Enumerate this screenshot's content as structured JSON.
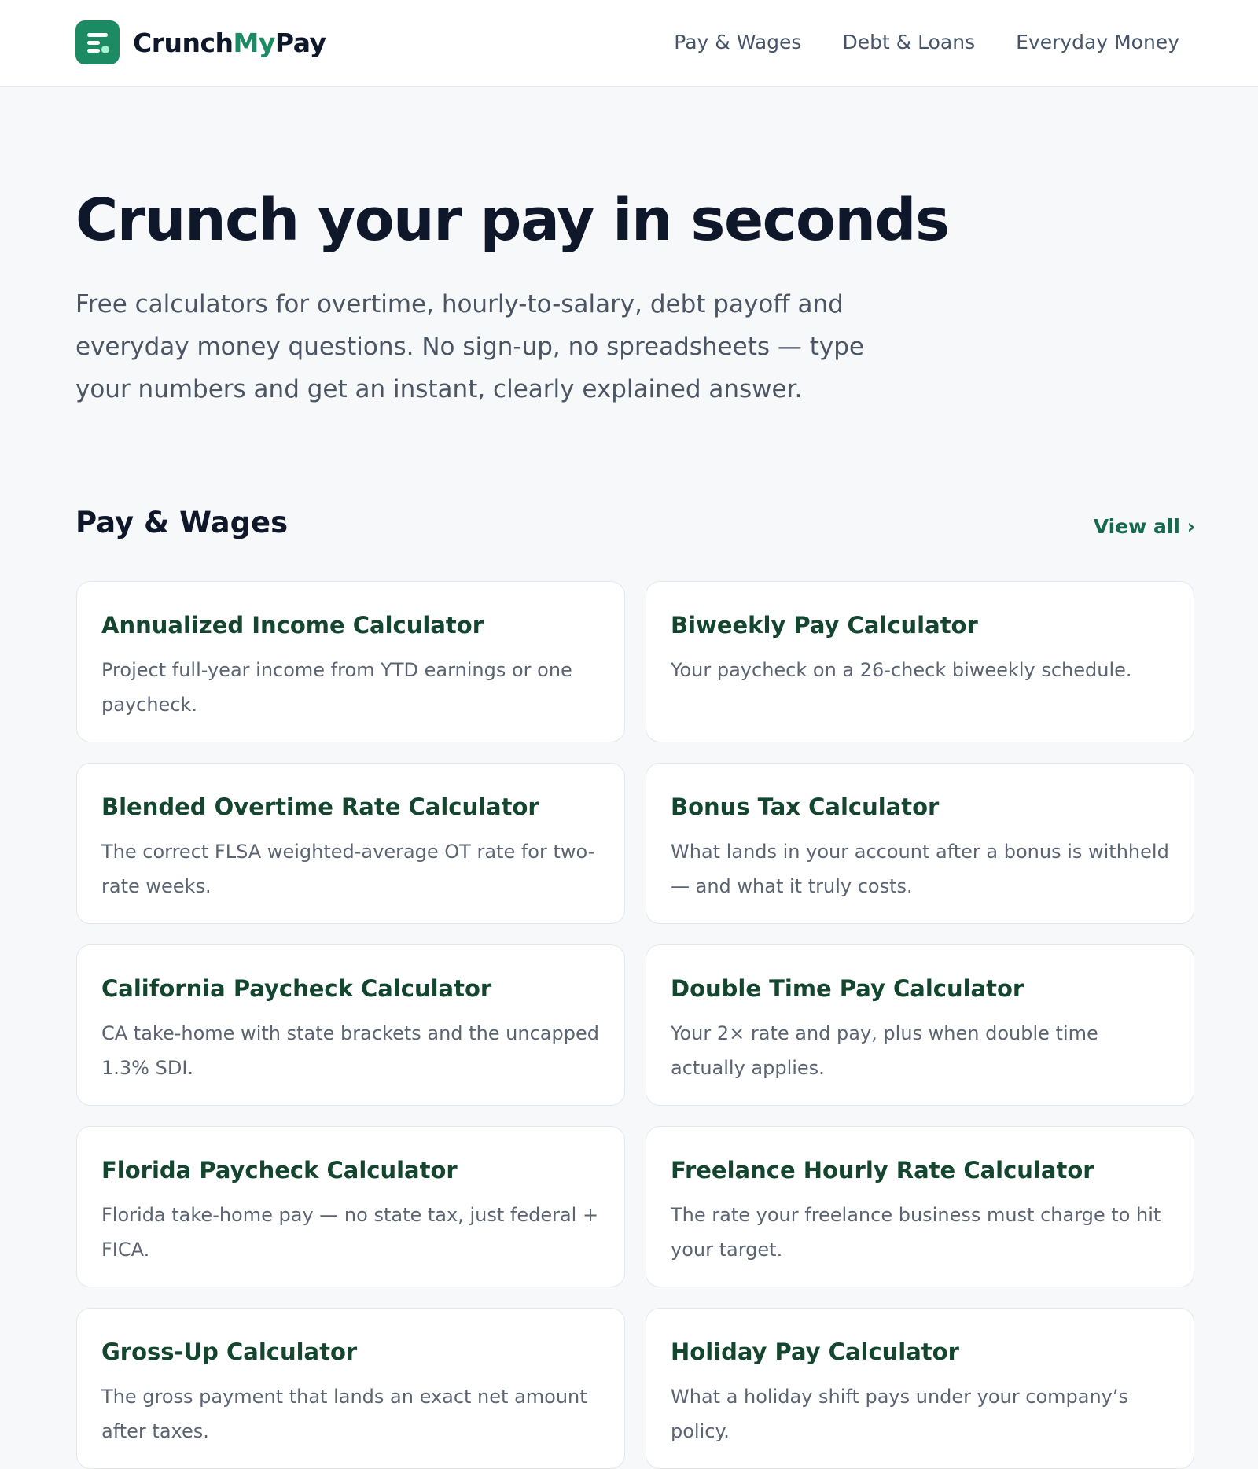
{
  "brand": {
    "name_part1": "Crunch",
    "name_part2": "My",
    "name_part3": "Pay",
    "accent_color": "#1c8a63",
    "logo_icon": "logo-bars-icon"
  },
  "nav": {
    "items": [
      {
        "label": "Pay & Wages"
      },
      {
        "label": "Debt & Loans"
      },
      {
        "label": "Everyday Money"
      }
    ]
  },
  "hero": {
    "title": "Crunch your pay in seconds",
    "subtitle": "Free calculators for overtime, hourly-to-salary, debt payoff and everyday money questions. No sign-up, no spreadsheets — type your numbers and get an instant, clearly explained answer."
  },
  "section": {
    "title": "Pay & Wages",
    "view_all_label": "View all ›",
    "cards": [
      {
        "title": "Annualized Income Calculator",
        "description": "Project full-year income from YTD earnings or one paycheck."
      },
      {
        "title": "Biweekly Pay Calculator",
        "description": "Your paycheck on a 26-check biweekly schedule."
      },
      {
        "title": "Blended Overtime Rate Calculator",
        "description": "The correct FLSA weighted-average OT rate for two-rate weeks."
      },
      {
        "title": "Bonus Tax Calculator",
        "description": "What lands in your account after a bonus is withheld — and what it truly costs."
      },
      {
        "title": "California Paycheck Calculator",
        "description": "CA take-home with state brackets and the uncapped 1.3% SDI."
      },
      {
        "title": "Double Time Pay Calculator",
        "description": "Your 2× rate and pay, plus when double time actually applies."
      },
      {
        "title": "Florida Paycheck Calculator",
        "description": "Florida take-home pay — no state tax, just federal + FICA."
      },
      {
        "title": "Freelance Hourly Rate Calculator",
        "description": "The rate your freelance business must charge to hit your target."
      },
      {
        "title": "Gross-Up Calculator",
        "description": "The gross payment that lands an exact net amount after taxes."
      },
      {
        "title": "Holiday Pay Calculator",
        "description": "What a holiday shift pays under your company’s policy."
      }
    ]
  }
}
